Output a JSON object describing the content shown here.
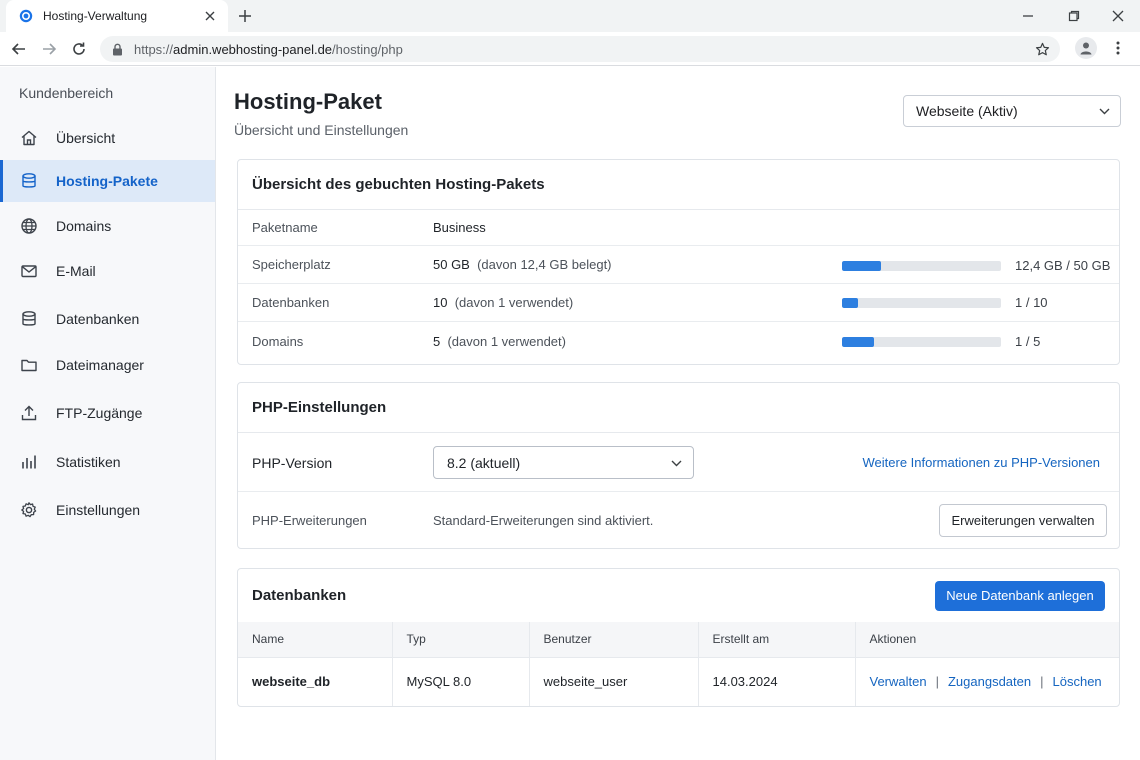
{
  "browser": {
    "tab_title": "Hosting-Verwaltung",
    "url_prefix": "https://",
    "url_host": "admin.webhosting-panel.de",
    "url_path": "/hosting/php"
  },
  "sidebar": {
    "heading": "Kundenbereich",
    "items": [
      {
        "label": "Übersicht",
        "icon": "home-icon"
      },
      {
        "label": "Hosting-Pakete",
        "icon": "database-icon",
        "active": true
      },
      {
        "label": "Domains",
        "icon": "globe-icon"
      },
      {
        "label": "E-Mail",
        "icon": "mail-icon"
      },
      {
        "label": "Datenbanken",
        "icon": "database-icon"
      },
      {
        "label": "Dateimanager",
        "icon": "folder-icon"
      },
      {
        "label": "FTP-Zugänge",
        "icon": "upload-icon"
      },
      {
        "label": "Statistiken",
        "icon": "bar-chart-icon"
      },
      {
        "label": "Einstellungen",
        "icon": "gear-icon"
      }
    ]
  },
  "header": {
    "title": "Hosting-Paket",
    "subtitle": "Übersicht und Einstellungen",
    "site_select": "Webseite (Aktiv)"
  },
  "package": {
    "heading": "Übersicht des gebuchten Hosting-Pakets",
    "name_label": "Paketname",
    "name_value": "Business",
    "rows": [
      {
        "label": "Speicherplatz",
        "value": "50 GB",
        "detail": "(davon 12,4 GB belegt)",
        "usage": "12,4 GB / 50 GB",
        "fraction": 0.248
      },
      {
        "label": "Datenbanken",
        "value": "10",
        "detail": "(davon 1 verwendet)",
        "usage": "1 / 10",
        "fraction": 0.1
      },
      {
        "label": "Domains",
        "value": "5",
        "detail": "(davon 1 verwendet)",
        "usage": "1 / 5",
        "fraction": 0.2
      }
    ]
  },
  "php": {
    "heading": "PHP-Einstellungen",
    "version_label": "PHP-Version",
    "version_value": "8.2 (aktuell)",
    "info_link": "Weitere Informationen zu PHP-Versionen",
    "ext_label": "PHP-Erweiterungen",
    "ext_value": "Standard-Erweiterungen sind aktiviert.",
    "ext_button": "Erweiterungen verwalten"
  },
  "databases": {
    "heading": "Datenbanken",
    "new_button": "Neue Datenbank anlegen",
    "columns": [
      "Name",
      "Typ",
      "Benutzer",
      "Erstellt am",
      "Aktionen"
    ],
    "rows": [
      {
        "name": "webseite_db",
        "type": "MySQL 8.0",
        "user": "webseite_user",
        "created": "14.03.2024",
        "actions": [
          "Verwalten",
          "Zugangsdaten",
          "Löschen"
        ],
        "separator": "|"
      }
    ]
  },
  "colors": {
    "accent": "#1e6fd9",
    "progress": "#2d7fe0",
    "active_bg": "#dde9f8"
  }
}
